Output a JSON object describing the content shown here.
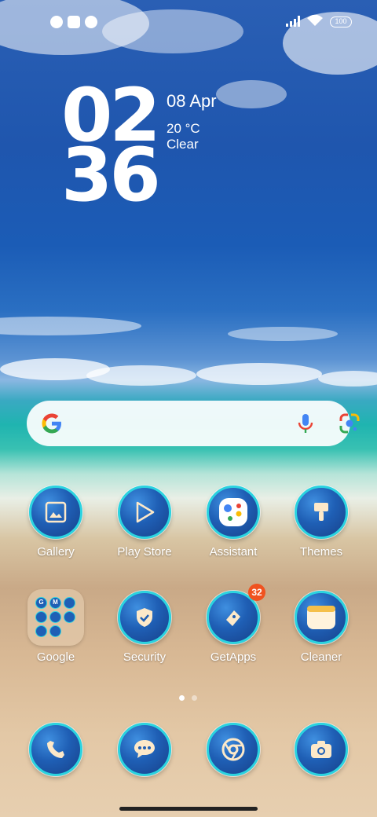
{
  "status_bar": {
    "battery_level": "100",
    "icons": [
      "app-notification-icon",
      "square-notification-icon",
      "app-notification-icon-2",
      "signal-icon",
      "wifi-icon",
      "battery-icon"
    ]
  },
  "clock_widget": {
    "hours": "02",
    "minutes": "36",
    "date": "08 Apr",
    "temperature": "20 °C",
    "condition": "Clear"
  },
  "search_bar": {
    "icons": [
      "google-g-icon",
      "microphone-icon",
      "google-lens-icon"
    ]
  },
  "apps": {
    "row1": [
      {
        "label": "Gallery",
        "icon": "gallery-icon"
      },
      {
        "label": "Play Store",
        "icon": "play-store-icon"
      },
      {
        "label": "Assistant",
        "icon": "assistant-icon"
      },
      {
        "label": "Themes",
        "icon": "themes-brush-icon"
      }
    ],
    "row2": [
      {
        "label": "Google",
        "icon": "google-folder-icon"
      },
      {
        "label": "Security",
        "icon": "security-shield-icon"
      },
      {
        "label": "GetApps",
        "icon": "getapps-icon",
        "badge": "32"
      },
      {
        "label": "Cleaner",
        "icon": "cleaner-icon"
      }
    ]
  },
  "folder_mini_icons": [
    "G",
    "M",
    "",
    "",
    "",
    "",
    "",
    "",
    ""
  ],
  "page_indicator": {
    "count": 2,
    "active": 1
  },
  "dock": [
    {
      "icon": "phone-icon"
    },
    {
      "icon": "messages-icon"
    },
    {
      "icon": "chrome-icon"
    },
    {
      "icon": "camera-icon"
    }
  ],
  "colors": {
    "icon_ring": "#2bd3e0",
    "icon_fill": "#1f5fb5",
    "badge": "#f0521f"
  }
}
